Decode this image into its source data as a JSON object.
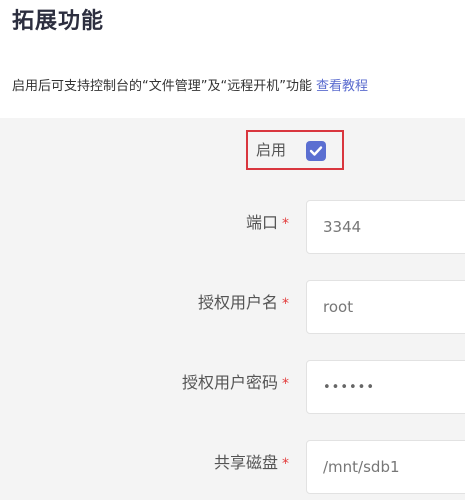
{
  "header": {
    "title": "拓展功能"
  },
  "description": {
    "text": "启用后可支持控制台的“文件管理”及“远程开机”功能",
    "link_text": "查看教程"
  },
  "form": {
    "enable": {
      "label": "启用",
      "checked": true
    },
    "port": {
      "label": "端口",
      "required_mark": "*",
      "value": "3344"
    },
    "username": {
      "label": "授权用户名",
      "required_mark": "*",
      "value": "root"
    },
    "password": {
      "label": "授权用户密码",
      "required_mark": "*",
      "value": "••••••"
    },
    "shared_disk": {
      "label": "共享磁盘",
      "required_mark": "*",
      "value": "/mnt/sdb1"
    }
  },
  "colors": {
    "accent": "#5b6fd1",
    "highlight_border": "#d9363e",
    "required": "#e23b3b",
    "link": "#5b6ccf"
  }
}
